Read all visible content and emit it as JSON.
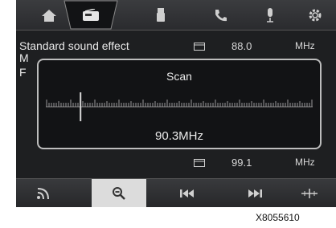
{
  "topbar": {
    "tabs": [
      {
        "name": "home",
        "icon": "home-icon"
      },
      {
        "name": "radio",
        "icon": "radio-icon",
        "active": true
      },
      {
        "name": "media",
        "icon": "usb-icon"
      },
      {
        "name": "phone",
        "icon": "phone-icon"
      },
      {
        "name": "voice",
        "icon": "microphone-icon"
      },
      {
        "name": "settings",
        "icon": "gear-icon"
      }
    ]
  },
  "station_list": {
    "header": "Standard sound effect",
    "partial_labels": [
      "M",
      "F"
    ],
    "rows": [
      {
        "frequency": "88.0",
        "unit": "MHz",
        "icon": "memory-icon"
      },
      {
        "frequency": "99.1",
        "unit": "MHz",
        "icon": "memory-icon"
      }
    ]
  },
  "scan_dialog": {
    "title": "Scan",
    "frequency": "90.3MHz",
    "needle_position": 0.1
  },
  "bottombar": {
    "buttons": [
      {
        "name": "signal",
        "icon": "signal-icon"
      },
      {
        "name": "search",
        "icon": "search-minus-icon",
        "active": true
      },
      {
        "name": "previous",
        "icon": "previous-icon"
      },
      {
        "name": "next",
        "icon": "next-icon"
      },
      {
        "name": "manual-tune",
        "icon": "tune-icon"
      }
    ]
  },
  "watermark": "X8055610",
  "colors": {
    "screen_bg": "#1e1f21",
    "active_button": "#dcdcdc",
    "dialog_border": "#bdbdbd"
  }
}
